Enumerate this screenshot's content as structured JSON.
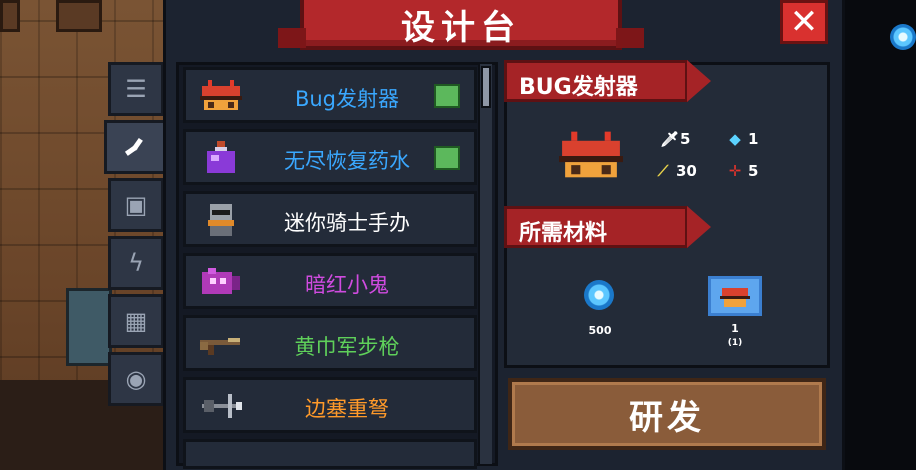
{
  "title": "设计台",
  "close_label": "✕",
  "tabs": [
    {
      "icon": "list-icon",
      "glyph": "☰",
      "active": false
    },
    {
      "icon": "wrench-icon",
      "glyph": "🔧",
      "active": true
    },
    {
      "icon": "armor-icon",
      "glyph": "▣",
      "active": false
    },
    {
      "icon": "lightning-icon",
      "glyph": "ϟ",
      "active": false
    },
    {
      "icon": "puzzle-icon",
      "glyph": "▦",
      "active": false
    },
    {
      "icon": "pet-icon",
      "glyph": "◉",
      "active": false
    }
  ],
  "items": [
    {
      "name": "Bug发射器",
      "color": "#3aa8ff",
      "icon": "bug-launcher-icon",
      "craftable": true
    },
    {
      "name": "无尽恢复药水",
      "color": "#3aa8ff",
      "icon": "potion-icon",
      "craftable": true
    },
    {
      "name": "迷你骑士手办",
      "color": "#ffffff",
      "icon": "knight-figure-icon",
      "craftable": false
    },
    {
      "name": "暗红小鬼",
      "color": "#d04be0",
      "icon": "crimson-imp-icon",
      "craftable": false
    },
    {
      "name": "黄巾军步枪",
      "color": "#5fd05a",
      "icon": "rifle-icon",
      "craftable": false
    },
    {
      "name": "边塞重弩",
      "color": "#ff9a2a",
      "icon": "crossbow-icon",
      "craftable": false
    }
  ],
  "detail": {
    "item_name": "BUG发射器",
    "stats": {
      "damage": "5",
      "energy": "1",
      "crit": "30",
      "spread": "5"
    },
    "materials_header": "所需材料",
    "materials": [
      {
        "icon": "gem-coin-icon",
        "amount": "500",
        "sub": ""
      },
      {
        "icon": "blueprint-icon",
        "amount": "1",
        "sub": "(1)"
      }
    ]
  },
  "build_label": "研发",
  "colors": {
    "banner": "#b3282b",
    "panel": "#1c2330",
    "button": "#8a5c3a"
  }
}
